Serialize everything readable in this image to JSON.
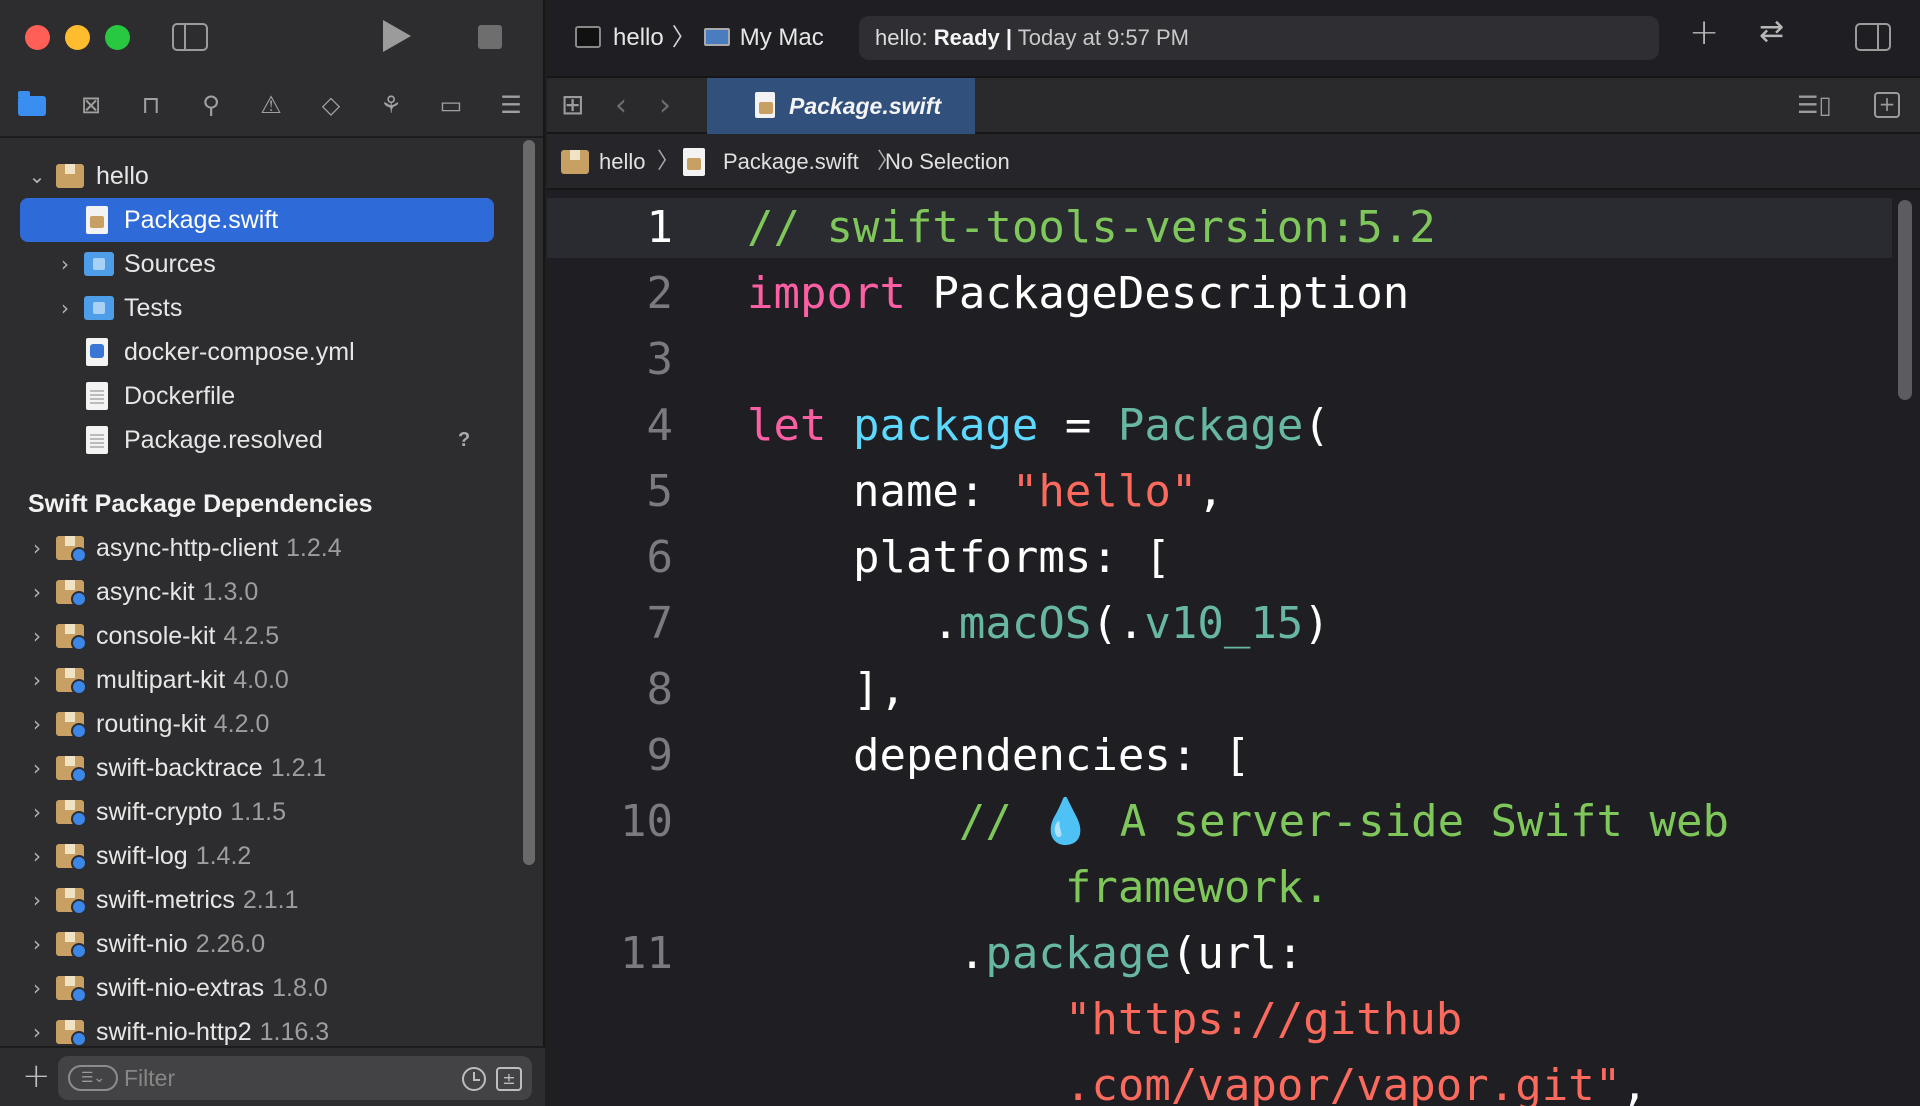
{
  "toolbar": {
    "scheme_target": "hello",
    "scheme_destination": "My Mac",
    "status_project": "hello:",
    "status_state": "Ready",
    "status_separator": "|",
    "status_time": "Today at 9:57 PM"
  },
  "tabs": [
    {
      "label": "Package.swift",
      "active": true
    }
  ],
  "jumpbar": [
    "hello",
    "Package.swift",
    "No Selection"
  ],
  "navigator": {
    "project": {
      "name": "hello",
      "items": [
        {
          "label": "Package.swift",
          "icon": "swift-file-icon",
          "selected": true
        },
        {
          "label": "Sources",
          "icon": "folder-icon",
          "expandable": true
        },
        {
          "label": "Tests",
          "icon": "folder-icon",
          "expandable": true
        },
        {
          "label": "docker-compose.yml",
          "icon": "yml-file-icon"
        },
        {
          "label": "Dockerfile",
          "icon": "text-file-icon"
        },
        {
          "label": "Package.resolved",
          "icon": "text-file-icon",
          "status": "?"
        }
      ]
    },
    "dependencies_header": "Swift Package Dependencies",
    "dependencies": [
      {
        "name": "async-http-client",
        "version": "1.2.4"
      },
      {
        "name": "async-kit",
        "version": "1.3.0"
      },
      {
        "name": "console-kit",
        "version": "4.2.5"
      },
      {
        "name": "multipart-kit",
        "version": "4.0.0"
      },
      {
        "name": "routing-kit",
        "version": "4.2.0"
      },
      {
        "name": "swift-backtrace",
        "version": "1.2.1"
      },
      {
        "name": "swift-crypto",
        "version": "1.1.5"
      },
      {
        "name": "swift-log",
        "version": "1.4.2"
      },
      {
        "name": "swift-metrics",
        "version": "2.1.1"
      },
      {
        "name": "swift-nio",
        "version": "2.26.0"
      },
      {
        "name": "swift-nio-extras",
        "version": "1.8.0"
      },
      {
        "name": "swift-nio-http2",
        "version": "1.16.3"
      }
    ],
    "filter_placeholder": "Filter"
  },
  "editor": {
    "current_line": 1,
    "lines": [
      {
        "num": "1",
        "tokens": [
          {
            "t": "// swift-tools-version:5.2",
            "c": "com"
          }
        ]
      },
      {
        "num": "2",
        "tokens": [
          {
            "t": "import",
            "c": "kw"
          },
          {
            "t": " PackageDescription",
            "c": "plain"
          }
        ]
      },
      {
        "num": "3",
        "tokens": []
      },
      {
        "num": "4",
        "tokens": [
          {
            "t": "let",
            "c": "kw"
          },
          {
            "t": " ",
            "c": "plain"
          },
          {
            "t": "package",
            "c": "decl"
          },
          {
            "t": " = ",
            "c": "plain"
          },
          {
            "t": "Package",
            "c": "type"
          },
          {
            "t": "(",
            "c": "plain"
          }
        ]
      },
      {
        "num": "5",
        "tokens": [
          {
            "t": "    name: ",
            "c": "plain"
          },
          {
            "t": "\"hello\"",
            "c": "str"
          },
          {
            "t": ",",
            "c": "plain"
          }
        ]
      },
      {
        "num": "6",
        "tokens": [
          {
            "t": "    platforms: [",
            "c": "plain"
          }
        ]
      },
      {
        "num": "7",
        "tokens": [
          {
            "t": "       .",
            "c": "plain"
          },
          {
            "t": "macOS",
            "c": "type"
          },
          {
            "t": "(.",
            "c": "plain"
          },
          {
            "t": "v10_15",
            "c": "type"
          },
          {
            "t": ")",
            "c": "plain"
          }
        ]
      },
      {
        "num": "8",
        "tokens": [
          {
            "t": "    ],",
            "c": "plain"
          }
        ]
      },
      {
        "num": "9",
        "tokens": [
          {
            "t": "    dependencies: [",
            "c": "plain"
          }
        ]
      },
      {
        "num": "10",
        "tokens": [
          {
            "t": "        // ",
            "c": "com"
          },
          {
            "t": "💧",
            "c": "emoji"
          },
          {
            "t": " A server-side Swift web",
            "c": "com"
          }
        ]
      },
      {
        "num": "",
        "tokens": [
          {
            "t": "            framework.",
            "c": "com"
          }
        ]
      },
      {
        "num": "11",
        "tokens": [
          {
            "t": "        .",
            "c": "plain"
          },
          {
            "t": "package",
            "c": "type"
          },
          {
            "t": "(url:",
            "c": "plain"
          }
        ]
      },
      {
        "num": "",
        "tokens": [
          {
            "t": "            ",
            "c": "plain"
          },
          {
            "t": "\"https://github",
            "c": "str"
          }
        ]
      },
      {
        "num": "",
        "tokens": [
          {
            "t": "            ",
            "c": "plain"
          },
          {
            "t": ".com/vapor/vapor.git\"",
            "c": "str"
          },
          {
            "t": ",",
            "c": "plain"
          }
        ]
      }
    ]
  },
  "colors": {
    "accent": "#2f6bd8",
    "comment": "#7fc75a",
    "keyword": "#fc5fa3",
    "type": "#67b7a4",
    "declaration": "#5dd8ff",
    "string": "#fc6a5d"
  }
}
